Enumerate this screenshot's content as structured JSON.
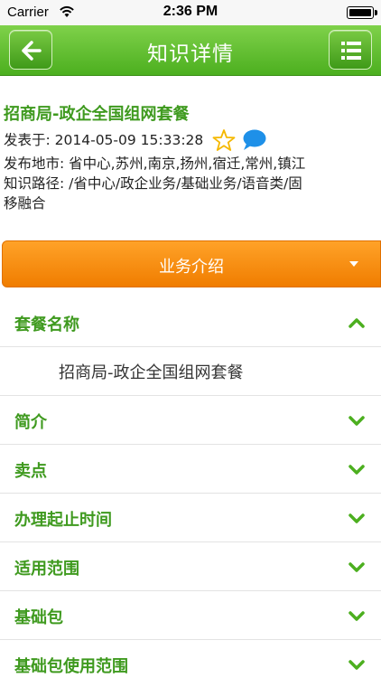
{
  "status": {
    "carrier": "Carrier",
    "time": "2:36 PM"
  },
  "nav": {
    "title": "知识详情",
    "back_icon": "back-arrow-icon",
    "menu_icon": "list-menu-icon"
  },
  "article": {
    "title": "招商局-政企全国组网套餐",
    "posted": "发表于: 2014-05-09 15:33:28",
    "city": "发布地市: 省中心,苏州,南京,扬州,宿迁,常州,镇江",
    "path_line1": "知识路径: /省中心/政企业务/基础业务/语音类/固",
    "path_line2": "移融合"
  },
  "section": {
    "label": "业务介绍"
  },
  "items": [
    {
      "label": "套餐名称",
      "expanded": true,
      "content": "招商局-政企全国组网套餐"
    },
    {
      "label": "简介"
    },
    {
      "label": "卖点"
    },
    {
      "label": "办理起止时间"
    },
    {
      "label": "适用范围"
    },
    {
      "label": "基础包"
    },
    {
      "label": "基础包使用范围"
    }
  ],
  "colors": {
    "green": "#4caf1f",
    "orange": "#f58a0c",
    "star": "#f5b800",
    "chat": "#1e90e8"
  }
}
